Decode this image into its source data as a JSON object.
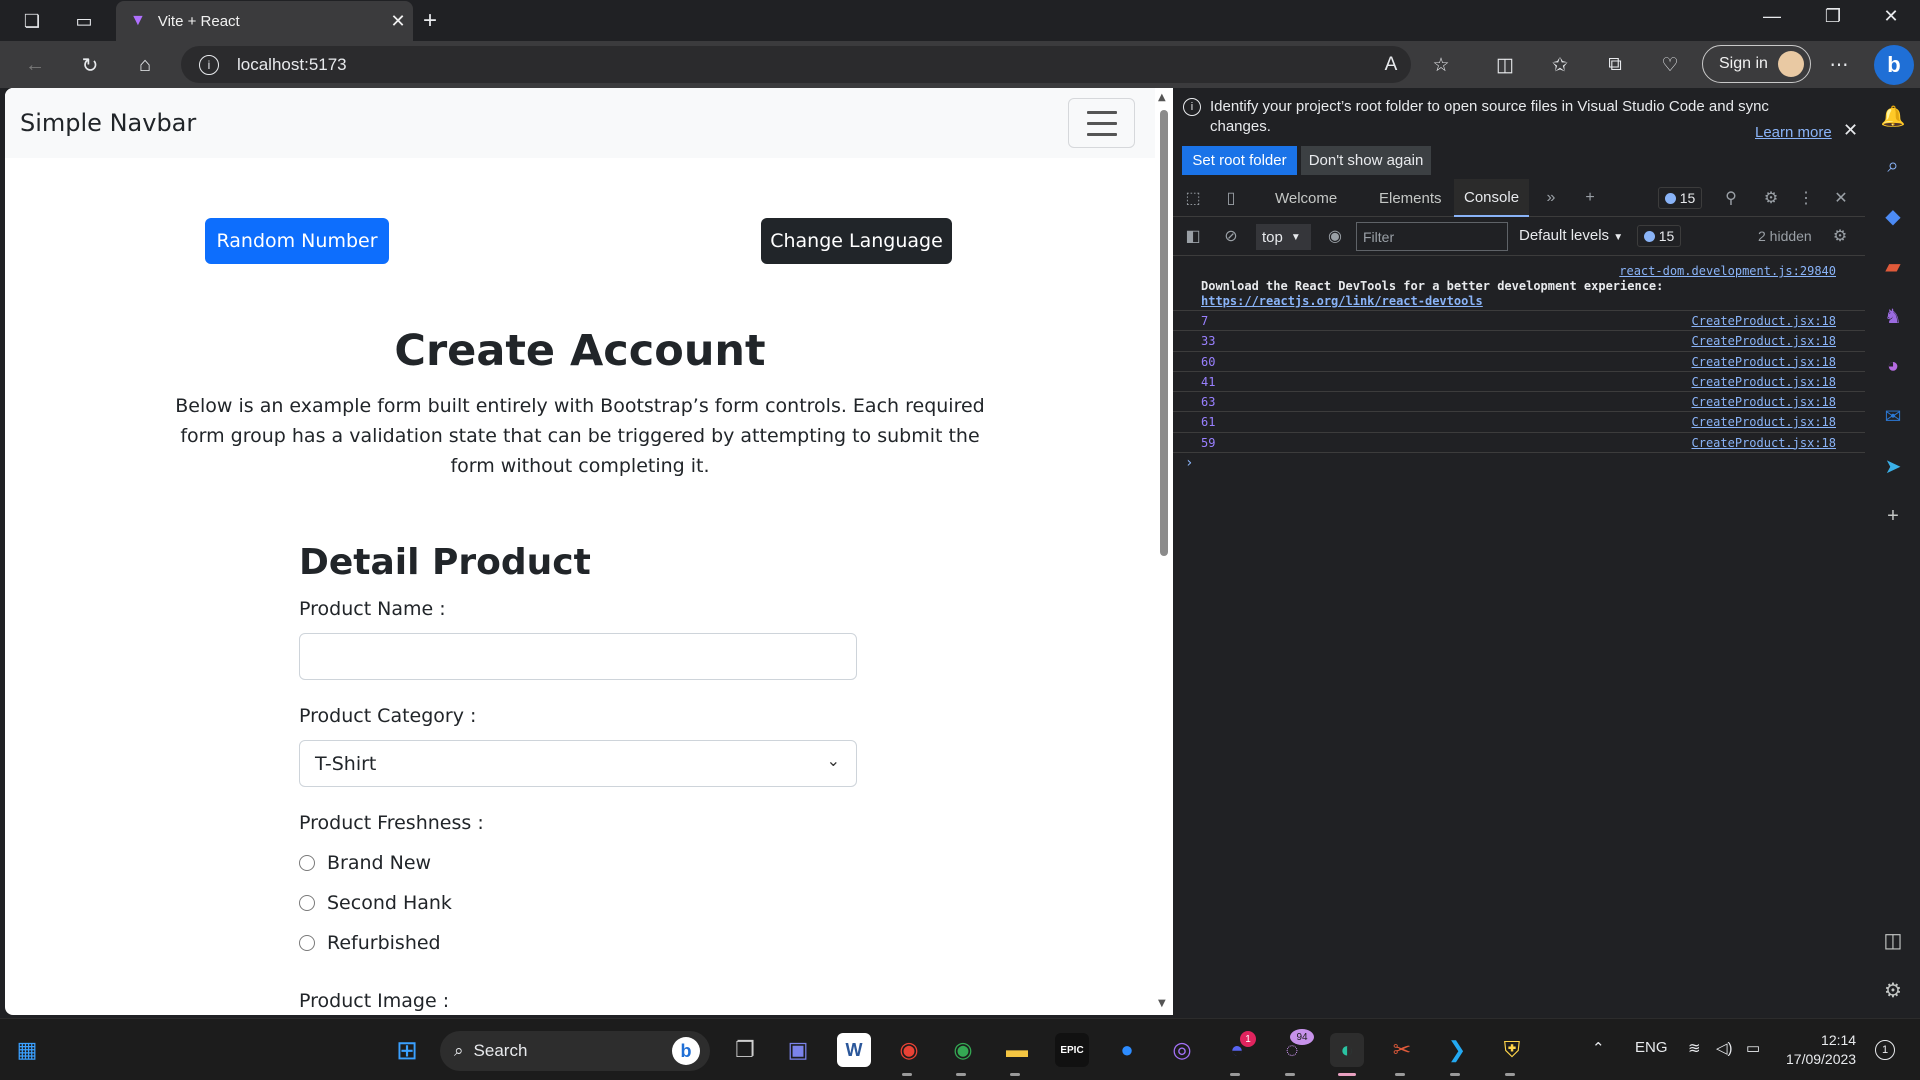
{
  "browser": {
    "tab_title": "Vite + React",
    "address": "localhost:5173",
    "signin_label": "Sign in",
    "bing_label": "b"
  },
  "page": {
    "brand": "Simple Navbar",
    "random_number_label": "Random Number",
    "change_language_label": "Change Language",
    "heading": "Create Account",
    "lead": "Below is an example form built entirely with Bootstrap’s form controls. Each required form group has a validation state that can be triggered by attempting to submit the form without completing it.",
    "form_title": "Detail Product",
    "product_name_label": "Product Name :",
    "product_name_value": "",
    "product_category_label": "Product Category :",
    "product_category_selected": "T-Shirt",
    "product_freshness_label": "Product Freshness :",
    "freshness_options": [
      "Brand New",
      "Second Hank",
      "Refurbished"
    ],
    "product_image_label": "Product Image :"
  },
  "devtools": {
    "info_message": "Identify your project’s root folder to open source files in Visual Studio Code and sync changes.",
    "learn_more": "Learn more",
    "set_root_folder": "Set root folder",
    "dont_show_again": "Don't show again",
    "tabs": [
      "Welcome",
      "Elements",
      "Console"
    ],
    "active_tab": "Console",
    "issue_count": "15",
    "context": "top",
    "filter_placeholder": "Filter",
    "levels_label": "Default levels",
    "levels_count": "15",
    "hidden_label": "2 hidden",
    "header_log": {
      "source": "react-dom.development.js:29840",
      "message": "Download the React DevTools for a better development experience: ",
      "link": "https://reactjs.org/link/react-devtools"
    },
    "logs": [
      {
        "value": "7",
        "source": "CreateProduct.jsx:18"
      },
      {
        "value": "33",
        "source": "CreateProduct.jsx:18"
      },
      {
        "value": "60",
        "source": "CreateProduct.jsx:18"
      },
      {
        "value": "41",
        "source": "CreateProduct.jsx:18"
      },
      {
        "value": "63",
        "source": "CreateProduct.jsx:18"
      },
      {
        "value": "61",
        "source": "CreateProduct.jsx:18"
      },
      {
        "value": "59",
        "source": "CreateProduct.jsx:18"
      }
    ],
    "prompt": "›"
  },
  "taskbar": {
    "search_label": "Search",
    "language": "ENG",
    "time": "12:14",
    "date": "17/09/2023",
    "discord_badge": "1",
    "app_badge": "94",
    "notification_count": "1"
  },
  "colors": {
    "bootstrap_primary": "#0d6efd",
    "bootstrap_dark": "#212529",
    "devtools_link": "#8ab4f8",
    "console_number": "#9980ff"
  }
}
